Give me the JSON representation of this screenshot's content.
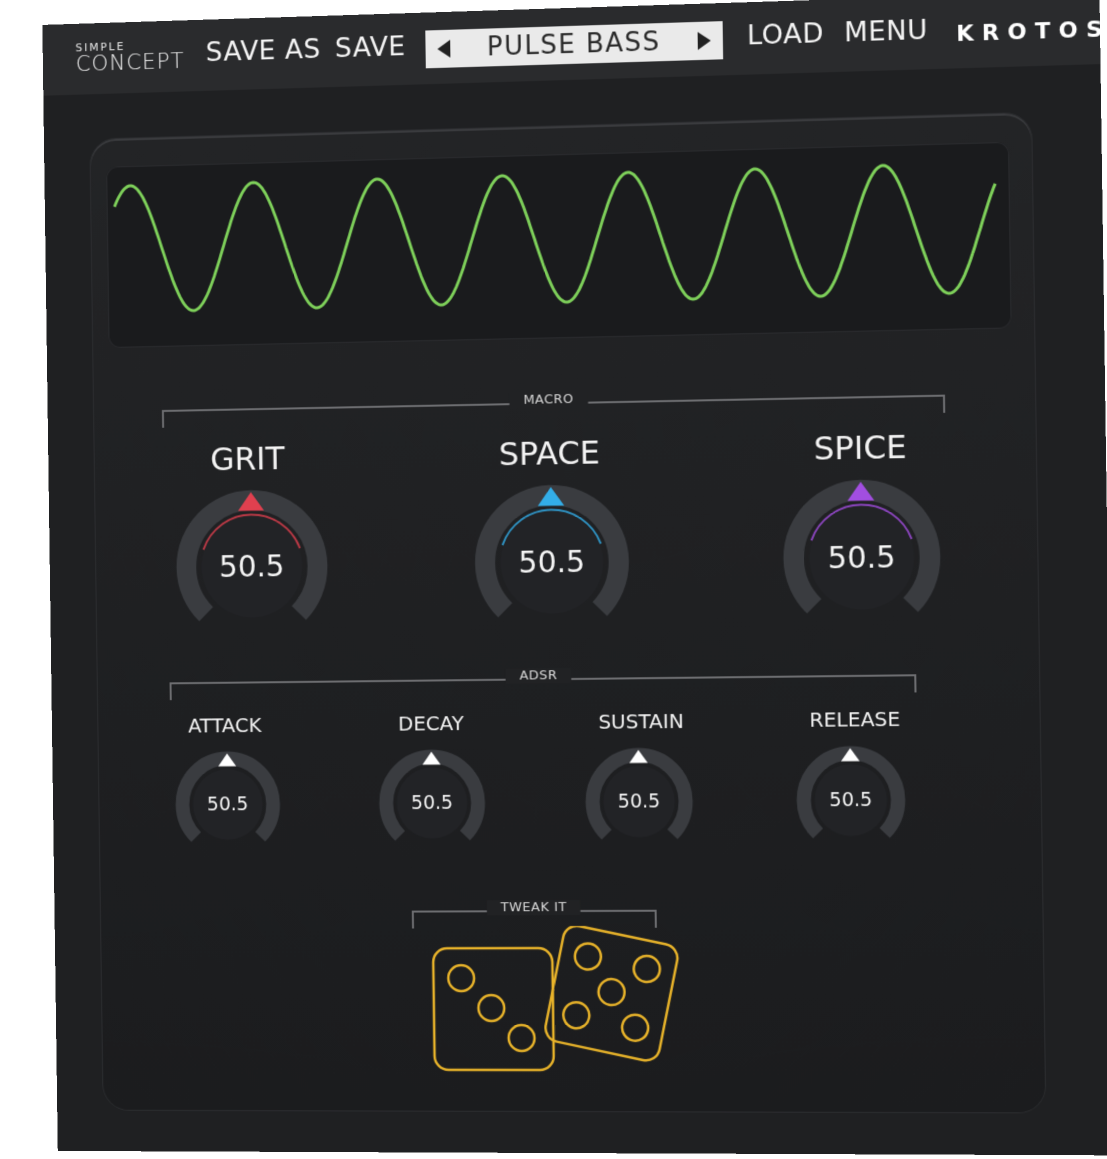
{
  "header": {
    "logo_top": "SIMPLE",
    "logo_bottom": "CONCEPT",
    "save_as_label": "SAVE AS",
    "save_label": "SAVE",
    "preset_name": "PULSE BASS",
    "load_label": "LOAD",
    "menu_label": "MENU",
    "brand": "KROTOS"
  },
  "macro": {
    "label": "MACRO",
    "knobs": [
      {
        "label": "GRIT",
        "value": "50.5",
        "color": "#e0404f"
      },
      {
        "label": "SPACE",
        "value": "50.5",
        "color": "#33aee8"
      },
      {
        "label": "SPICE",
        "value": "50.5",
        "color": "#a24ee0"
      }
    ]
  },
  "adsr": {
    "label": "ADSR",
    "knobs": [
      {
        "label": "ATTACK",
        "value": "50.5"
      },
      {
        "label": "DECAY",
        "value": "50.5"
      },
      {
        "label": "SUSTAIN",
        "value": "50.5"
      },
      {
        "label": "RELEASE",
        "value": "50.5"
      }
    ]
  },
  "tweak": {
    "label": "TWEAK IT",
    "dice_color": "#e8b32a"
  },
  "scope": {
    "wave_color": "#7ed05a"
  }
}
